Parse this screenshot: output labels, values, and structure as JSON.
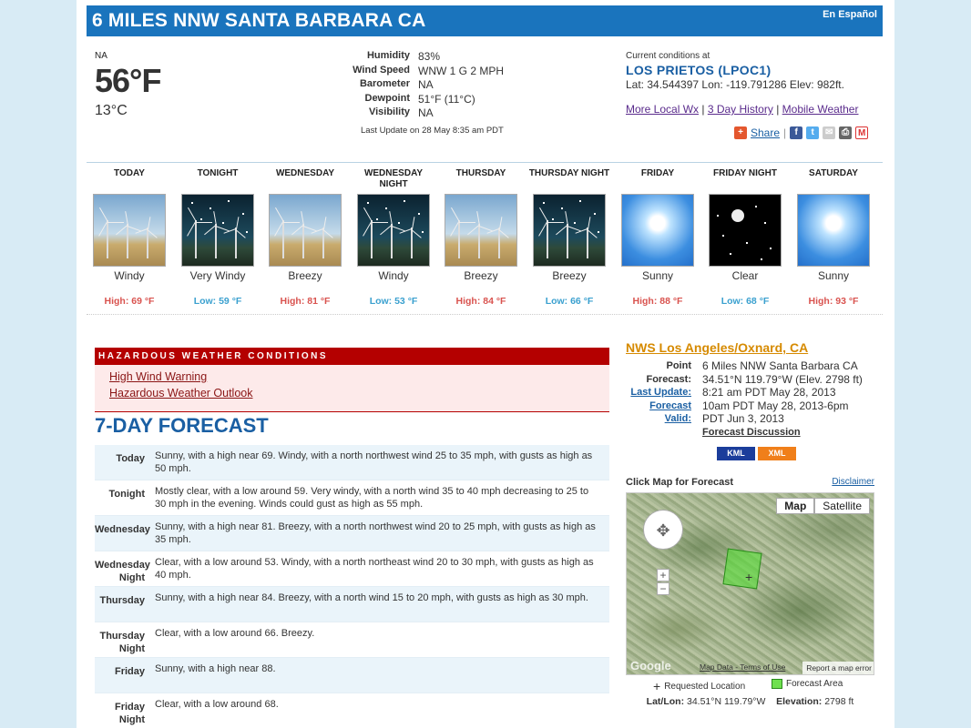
{
  "header": {
    "title": "6 MILES NNW SANTA BARBARA CA",
    "lang_link": "En Español"
  },
  "current": {
    "na": "NA",
    "temp_f": "56°F",
    "temp_c": "13°C",
    "rows": [
      {
        "label": "Humidity",
        "value": "83%"
      },
      {
        "label": "Wind Speed",
        "value": "WNW 1 G 2 MPH"
      },
      {
        "label": "Barometer",
        "value": "NA"
      },
      {
        "label": "Dewpoint",
        "value": "51°F (11°C)"
      },
      {
        "label": "Visibility",
        "value": "NA"
      }
    ],
    "last_update": "Last Update on 28 May 8:35 am PDT",
    "station_label": "Current conditions at",
    "station_name": "LOS PRIETOS (LPOC1)",
    "station_coords": "Lat: 34.544397 Lon: -119.791286 Elev: 982ft.",
    "links": [
      "More Local Wx",
      "3 Day History",
      "Mobile Weather"
    ],
    "share": "Share"
  },
  "strip": [
    {
      "period": "TODAY",
      "desc": "Windy",
      "temp": "High: 69 °F",
      "kind": "hi",
      "img": "wind-day"
    },
    {
      "period": "TONIGHT",
      "desc": "Very Windy",
      "temp": "Low: 59 °F",
      "kind": "lo",
      "img": "wind-night"
    },
    {
      "period": "WEDNESDAY",
      "desc": "Breezy",
      "temp": "High: 81 °F",
      "kind": "hi",
      "img": "wind-day"
    },
    {
      "period": "WEDNESDAY NIGHT",
      "desc": "Windy",
      "temp": "Low: 53 °F",
      "kind": "lo",
      "img": "wind-night"
    },
    {
      "period": "THURSDAY",
      "desc": "Breezy",
      "temp": "High: 84 °F",
      "kind": "hi",
      "img": "wind-day"
    },
    {
      "period": "THURSDAY NIGHT",
      "desc": "Breezy",
      "temp": "Low: 66 °F",
      "kind": "lo",
      "img": "wind-night"
    },
    {
      "period": "FRIDAY",
      "desc": "Sunny",
      "temp": "High: 88 °F",
      "kind": "hi",
      "img": "sunny"
    },
    {
      "period": "FRIDAY NIGHT",
      "desc": "Clear",
      "temp": "Low: 68 °F",
      "kind": "lo",
      "img": "clear"
    },
    {
      "period": "SATURDAY",
      "desc": "Sunny",
      "temp": "High: 93 °F",
      "kind": "hi",
      "img": "sunny"
    }
  ],
  "hazards": {
    "header": "HAZARDOUS WEATHER CONDITIONS",
    "items": [
      "High Wind Warning",
      "Hazardous Weather Outlook"
    ]
  },
  "seven_day": {
    "title": "7-DAY FORECAST",
    "rows": [
      {
        "day": "Today",
        "text": "Sunny, with a high near 69. Windy, with a north northwest wind 25 to 35 mph, with gusts as high as 50 mph."
      },
      {
        "day": "Tonight",
        "text": "Mostly clear, with a low around 59. Very windy, with a north wind 35 to 40 mph decreasing to 25 to 30 mph in the evening. Winds could gust as high as 55 mph."
      },
      {
        "day": "Wednesday",
        "text": "Sunny, with a high near 81. Breezy, with a north northwest wind 20 to 25 mph, with gusts as high as 35 mph."
      },
      {
        "day": "Wednesday Night",
        "text": "Clear, with a low around 53. Windy, with a north northeast wind 20 to 30 mph, with gusts as high as 40 mph."
      },
      {
        "day": "Thursday",
        "text": "Sunny, with a high near 84. Breezy, with a north wind 15 to 20 mph, with gusts as high as 30 mph."
      },
      {
        "day": "Thursday Night",
        "text": "Clear, with a low around 66. Breezy."
      },
      {
        "day": "Friday",
        "text": "Sunny, with a high near 88."
      },
      {
        "day": "Friday Night",
        "text": "Clear, with a low around 68."
      }
    ]
  },
  "office": {
    "name": "NWS Los Angeles/Oxnard, CA",
    "rows": [
      {
        "label": "Point Forecast:",
        "value": "6 Miles NNW Santa Barbara CA 34.51°N 119.79°W (Elev. 2798 ft)",
        "link": false
      },
      {
        "label": "Last Update:",
        "value": "8:21 am PDT May 28, 2013",
        "link": true
      },
      {
        "label": "Forecast Valid:",
        "value": "10am PDT May 28, 2013-6pm PDT Jun 3, 2013",
        "link": true
      }
    ],
    "discussion": "Forecast Discussion",
    "kml": "KML",
    "xml": "XML"
  },
  "map": {
    "heading": "Click Map for Forecast",
    "disclaimer": "Disclaimer",
    "btn_map": "Map",
    "btn_sat": "Satellite",
    "google": "Google",
    "footer_links": "Map Data - Terms of Use",
    "report": "Report a map error",
    "legend_requested": "Requested Location",
    "legend_area": "Forecast Area",
    "latlon_label": "Lat/Lon:",
    "latlon_value": "34.51°N 119.79°W",
    "elev_label": "Elevation:",
    "elev_value": "2798 ft"
  }
}
